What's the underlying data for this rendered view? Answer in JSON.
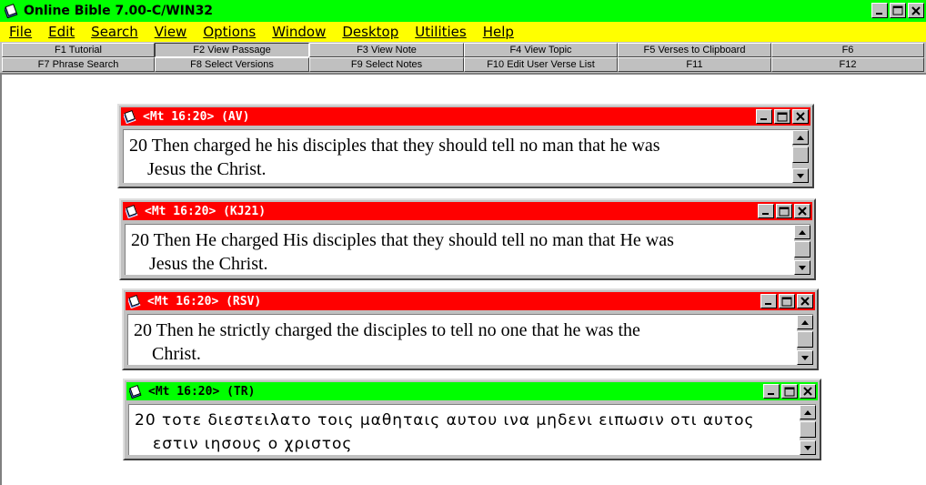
{
  "app": {
    "title": "Online Bible 7.00-C/WIN32",
    "titlebar_color": "#00ff00",
    "menubar_color": "#ffff00"
  },
  "menu": [
    "File",
    "Edit",
    "Search",
    "View",
    "Options",
    "Window",
    "Desktop",
    "Utilities",
    "Help"
  ],
  "function_keys": {
    "row1": [
      "F1 Tutorial",
      "F2 View Passage",
      "F3 View Note",
      "F4 View Topic",
      "F5 Verses to Clipboard",
      "F6"
    ],
    "row2": [
      "F7 Phrase Search",
      "F8 Select Versions",
      "F9 Select Notes",
      "F10 Edit User Verse List",
      "F11",
      "F12"
    ]
  },
  "verse_windows": [
    {
      "title": "<Mt 16:20> (AV)",
      "title_color": "#ff0000",
      "line1": "20  Then charged he his disciples that they should tell no man that he was",
      "line2": "Jesus the Christ."
    },
    {
      "title": "<Mt 16:20> (KJ21)",
      "title_color": "#ff0000",
      "line1": "20  Then He charged His disciples that they should tell no man that He was",
      "line2": "Jesus the Christ."
    },
    {
      "title": "<Mt 16:20> (RSV)",
      "title_color": "#ff0000",
      "line1": "20  Then he strictly charged the disciples to tell no one that he was the",
      "line2": "Christ."
    },
    {
      "title": "<Mt 16:20> (TR)",
      "title_color": "#00ff00",
      "line1": "20 τοτε διεστειλατο τοις μαθηταις αυτου ινα μηδενι ειπωσιν οτι αυτος",
      "line2": "εστιν ιησους ο χριστος"
    }
  ],
  "icons": {
    "app": "bible-icon",
    "minimize": "minimize-icon",
    "maximize": "maximize-icon",
    "close": "close-icon",
    "scroll_up": "scroll-up-arrow-icon",
    "scroll_down": "scroll-down-arrow-icon"
  }
}
